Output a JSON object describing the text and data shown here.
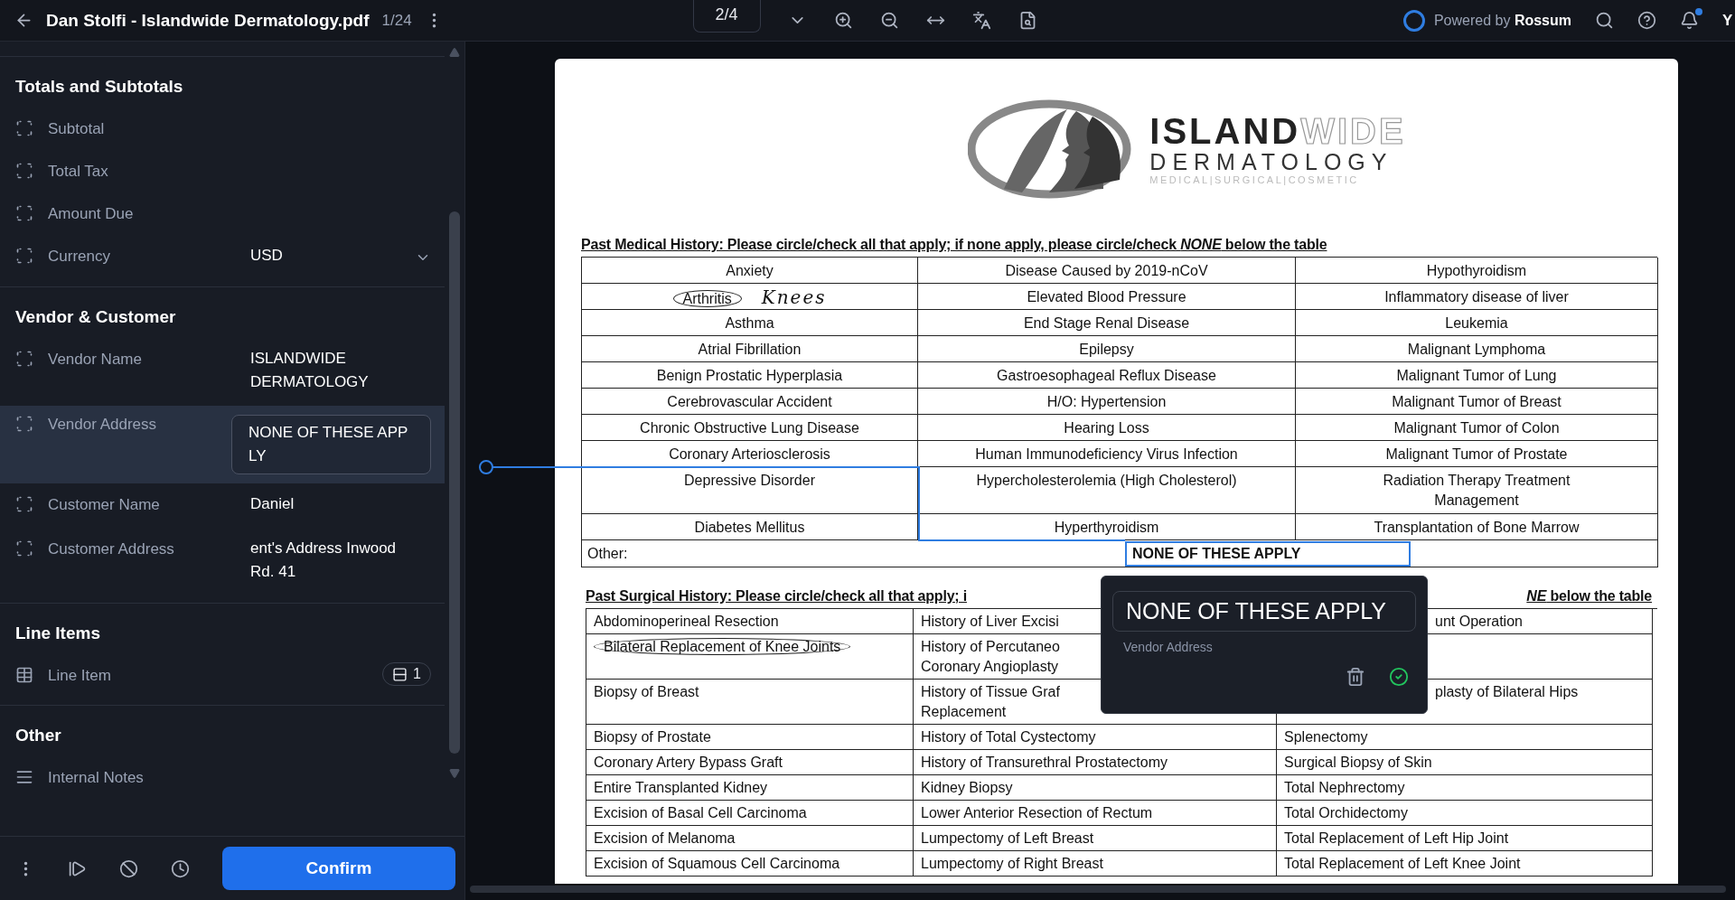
{
  "header": {
    "title": "Dan Stolfi - Islandwide Dermatology.pdf",
    "doc_counter": "1/24",
    "page_indicator": "2/4",
    "powered_by": "Powered by **Rossum**",
    "user_initial": "Y",
    "notification": true
  },
  "sidebar": {
    "sections": [
      {
        "title": "Totals and Subtotals",
        "fields": [
          {
            "kind": "field",
            "label": "Subtotal",
            "selected": false
          },
          {
            "kind": "field",
            "label": "Total Tax",
            "selected": false
          },
          {
            "kind": "field",
            "label": "Amount Due",
            "selected": false
          },
          {
            "kind": "select",
            "label": "Currency",
            "value": "USD",
            "selected": false
          }
        ]
      },
      {
        "title": "Vendor & Customer",
        "fields": [
          {
            "kind": "field",
            "label": "Vendor Name",
            "value": "ISLANDWIDE DERMATOLOGY",
            "selected": false
          },
          {
            "kind": "field",
            "label": "Vendor Address",
            "value": "NONE OF THESE APPLY",
            "selected": true
          },
          {
            "kind": "field",
            "label": "Customer Name",
            "value": "Daniel",
            "selected": false
          },
          {
            "kind": "field",
            "label": "Customer Address",
            "value": "ent's Address Inwood Rd. 41",
            "selected": false
          }
        ]
      },
      {
        "title": "Line Items",
        "fields": [
          {
            "kind": "table",
            "label": "Line Item",
            "count": "1",
            "selected": false
          }
        ]
      },
      {
        "title": "Other",
        "fields": [
          {
            "kind": "notes",
            "label": "Internal Notes",
            "selected": false
          }
        ]
      }
    ],
    "confirm": "Confirm"
  },
  "document": {
    "logo": {
      "name": "**ISLAND**WIDE",
      "subtitle": "DERMATOLOGY",
      "tagline": "MEDICAL|SURGICAL|COSMETIC"
    },
    "medical_history": {
      "heading": "Past Medical History: Please circle/check all that apply; if none apply, please circle/check *NONE* below the table",
      "rows": [
        [
          {
            "text": "Anxiety",
            "circled": false
          },
          {
            "text": "Disease Caused by 2019-nCoV",
            "circled": false
          },
          {
            "text": "Hypothyroidism",
            "circled": false
          }
        ],
        [
          {
            "text": "Arthritis",
            "circled": true,
            "note": "Knees"
          },
          {
            "text": "Elevated Blood Pressure",
            "circled": false
          },
          {
            "text": "Inflammatory disease of liver",
            "circled": false
          }
        ],
        [
          {
            "text": "Asthma",
            "circled": false
          },
          {
            "text": "End Stage Renal Disease",
            "circled": false
          },
          {
            "text": "Leukemia",
            "circled": false
          }
        ],
        [
          {
            "text": "Atrial Fibrillation",
            "circled": false
          },
          {
            "text": "Epilepsy",
            "circled": false
          },
          {
            "text": "Malignant Lymphoma",
            "circled": false
          }
        ],
        [
          {
            "text": "Benign Prostatic Hyperplasia",
            "circled": false
          },
          {
            "text": "Gastroesophageal Reflux Disease",
            "circled": false
          },
          {
            "text": "Malignant Tumor of Lung",
            "circled": false
          }
        ],
        [
          {
            "text": "Cerebrovascular Accident",
            "circled": false
          },
          {
            "text": "H/O: Hypertension",
            "circled": false
          },
          {
            "text": "Malignant Tumor of Breast",
            "circled": false
          }
        ],
        [
          {
            "text": "Chronic Obstructive Lung Disease",
            "circled": false
          },
          {
            "text": "Hearing Loss",
            "circled": false
          },
          {
            "text": "Malignant Tumor of Colon",
            "circled": false
          }
        ],
        [
          {
            "text": "Coronary Arteriosclerosis",
            "circled": false
          },
          {
            "text": "Human Immunodeficiency Virus Infection",
            "circled": false
          },
          {
            "text": "Malignant Tumor of Prostate",
            "circled": false
          }
        ],
        [
          {
            "text": "Depressive Disorder",
            "circled": false
          },
          {
            "text": "Hypercholesterolemia (High Cholesterol)",
            "circled": false
          },
          {
            "text": "Radiation Therapy Treatment\nManagement",
            "circled": false
          }
        ],
        [
          {
            "text": "Diabetes Mellitus",
            "circled": false
          },
          {
            "text": "Hyperthyroidism",
            "circled": false
          },
          {
            "text": "Transplantation of Bone Marrow",
            "circled": false
          }
        ]
      ],
      "other_label": "Other:",
      "other_value": "NONE OF THESE APPLY",
      "other_highlighted": true
    },
    "surgical_history": {
      "heading_left": "Past Surgical History: Please circle/check all that apply; i",
      "heading_right": "*NE* below the table",
      "rows": [
        [
          {
            "text": "Abdominoperineal Resection",
            "circled": false,
            "covered": false
          },
          {
            "text": "History of Liver Excisi",
            "circled": false,
            "covered": false
          },
          {
            "text": "unt Operation",
            "circled": false,
            "covered": true
          }
        ],
        [
          {
            "text": "Bilateral Replacement of Knee Joints",
            "circled": true,
            "covered": false
          },
          {
            "text": "History of Percutaneo\nCoronary Angioplasty",
            "circled": false,
            "covered": false
          },
          {}
        ],
        [
          {
            "text": "Biopsy of Breast",
            "circled": false,
            "covered": false
          },
          {
            "text": "History of Tissue Graf\nReplacement",
            "circled": false,
            "covered": false
          },
          {
            "text": "plasty of Bilateral Hips",
            "circled": false,
            "covered": true
          }
        ],
        [
          {
            "text": "Biopsy of Prostate",
            "circled": false,
            "covered": false
          },
          {
            "text": "History of Total Cystectomy",
            "circled": false,
            "covered": false
          },
          {
            "text": "Splenectomy",
            "circled": false,
            "covered": false
          }
        ],
        [
          {
            "text": "Coronary Artery Bypass Graft",
            "circled": false,
            "covered": false
          },
          {
            "text": "History of Transurethral Prostatectomy",
            "circled": false,
            "covered": false
          },
          {
            "text": "Surgical Biopsy of Skin",
            "circled": false,
            "covered": false
          }
        ],
        [
          {
            "text": "Entire Transplanted Kidney",
            "circled": false,
            "covered": false
          },
          {
            "text": "Kidney Biopsy",
            "circled": false,
            "covered": false
          },
          {
            "text": "Total Nephrectomy",
            "circled": false,
            "covered": false
          }
        ],
        [
          {
            "text": "Excision of Basal Cell Carcinoma",
            "circled": false,
            "covered": false
          },
          {
            "text": "Lower Anterior Resection of Rectum",
            "circled": false,
            "covered": false
          },
          {
            "text": "Total Orchidectomy",
            "circled": false,
            "covered": false
          }
        ],
        [
          {
            "text": "Excision of Melanoma",
            "circled": false,
            "covered": false
          },
          {
            "text": "Lumpectomy of Left Breast",
            "circled": false,
            "covered": false
          },
          {
            "text": "Total Replacement of Left Hip Joint",
            "circled": false,
            "covered": false
          }
        ],
        [
          {
            "text": "Excision of Squamous Cell Carcinoma",
            "circled": false,
            "covered": false
          },
          {
            "text": "Lumpectomy of Right Breast",
            "circled": false,
            "covered": false
          },
          {
            "text": "Total Replacement of Left Knee Joint",
            "circled": false,
            "covered": false
          }
        ]
      ]
    }
  },
  "annotation_popup": {
    "value": "NONE OF THESE APPLY",
    "label": "Vendor Address"
  }
}
